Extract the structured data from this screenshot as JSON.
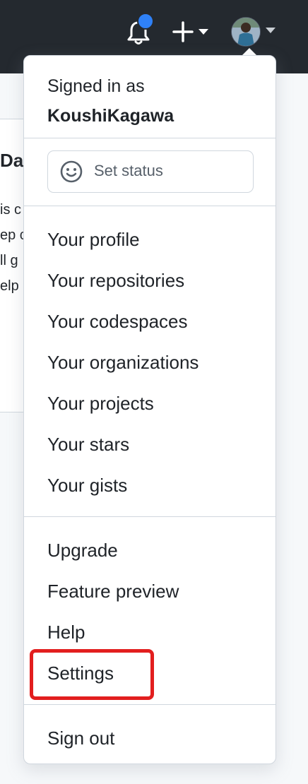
{
  "header": {
    "notification_icon": "bell-icon",
    "create_icon": "plus-icon",
    "avatar_icon": "avatar",
    "accent_color": "#2f81f7"
  },
  "background": {
    "heading": "Da",
    "lines": [
      "is c",
      "ep c",
      "ll g",
      "elp"
    ]
  },
  "menu": {
    "signed_in_label": "Signed in as",
    "username": "KoushiKagawa",
    "status_label": "Set status",
    "profile_items": [
      "Your profile",
      "Your repositories",
      "Your codespaces",
      "Your organizations",
      "Your projects",
      "Your stars",
      "Your gists"
    ],
    "utility_items": [
      "Upgrade",
      "Feature preview",
      "Help",
      "Settings"
    ],
    "sign_out": "Sign out",
    "highlighted_item": "Settings",
    "highlight_color": "#e21e1e"
  }
}
